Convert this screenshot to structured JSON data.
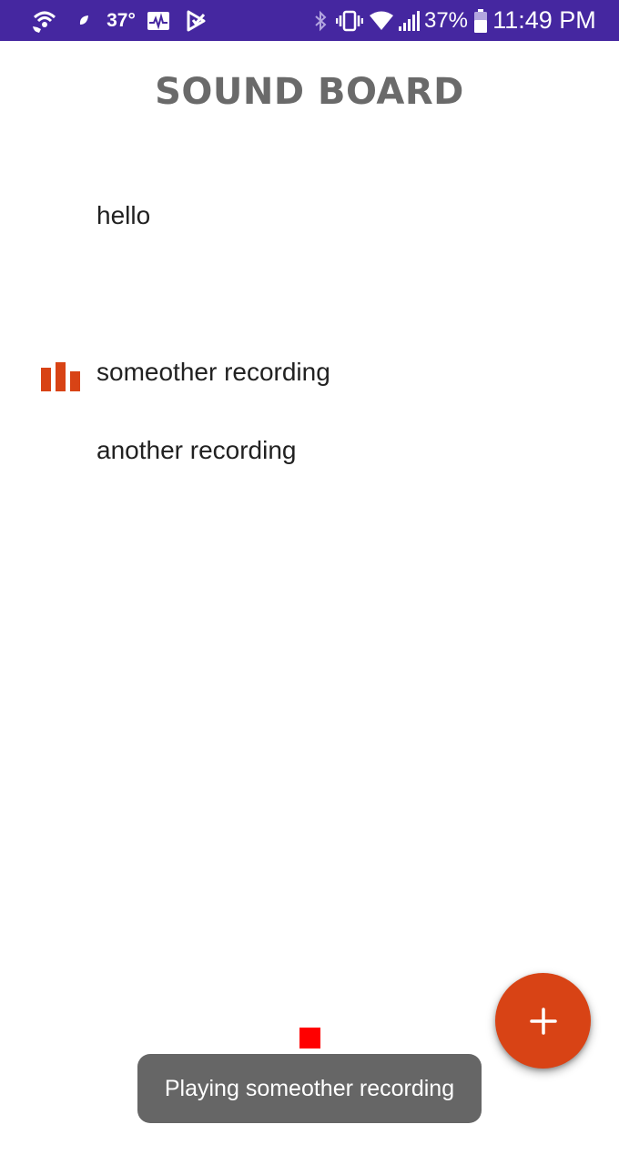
{
  "status_bar": {
    "temperature": "37°",
    "battery_percent": "37%",
    "time": "11:49 PM",
    "icons": [
      "wifi-call-icon",
      "leaf-icon",
      "pulse-monitor-icon",
      "check-flag-icon",
      "bluetooth-icon",
      "vibrate-icon",
      "wifi-icon",
      "signal-icon",
      "battery-icon"
    ],
    "background_color": "#4527a0"
  },
  "app": {
    "title": "SOUND BOARD",
    "accent_color": "#d84315"
  },
  "recordings": [
    {
      "label": "hello",
      "playing": false
    },
    {
      "label": "someother recording",
      "playing": true
    },
    {
      "label": "another recording",
      "playing": false
    }
  ],
  "fab": {
    "icon": "plus-icon",
    "color": "#d84315"
  },
  "stop_button": {
    "icon": "stop-icon",
    "color": "#ff0000"
  },
  "toast": {
    "message": "Playing someother recording"
  }
}
